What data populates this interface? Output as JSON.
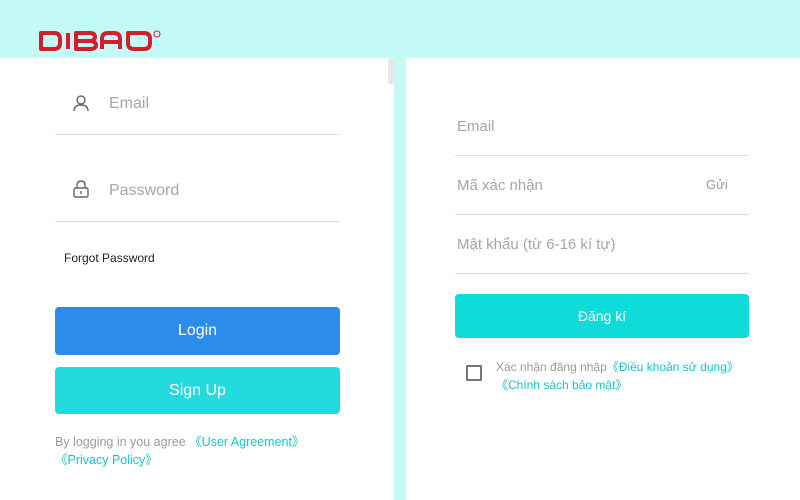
{
  "brand": {
    "logo_text": "DIBAO"
  },
  "login": {
    "email_placeholder": "Email",
    "password_placeholder": "Password",
    "forgot_label": "Forgot Password",
    "login_label": "Login",
    "signup_label": "Sign Up",
    "agreement_prefix": "By logging in you agree ",
    "user_agreement": "《User Agreement》",
    "privacy_policy": "《Privacy Policy》"
  },
  "register": {
    "email_placeholder": "Email",
    "code_placeholder": "Mã xác nhận",
    "send_label": "Gửi",
    "password_placeholder": "Mật khẩu (từ 6-16 kí tự)",
    "register_label": "Đăng kí",
    "confirm_prefix": "Xác nhận đăng nhập",
    "terms_link": "《Điều khoản sử dụng》",
    "privacy_link": "《Chính sách bảo mật》"
  },
  "colors": {
    "background": "#c3faf8",
    "login_button": "#2b8ceb",
    "signup_button": "#23dbdd",
    "register_button": "#0fdcd8",
    "link": "#17c4c8",
    "logo": "#d21f2b"
  },
  "icons": {
    "email_field": "user-icon",
    "password_field": "lock-icon"
  }
}
